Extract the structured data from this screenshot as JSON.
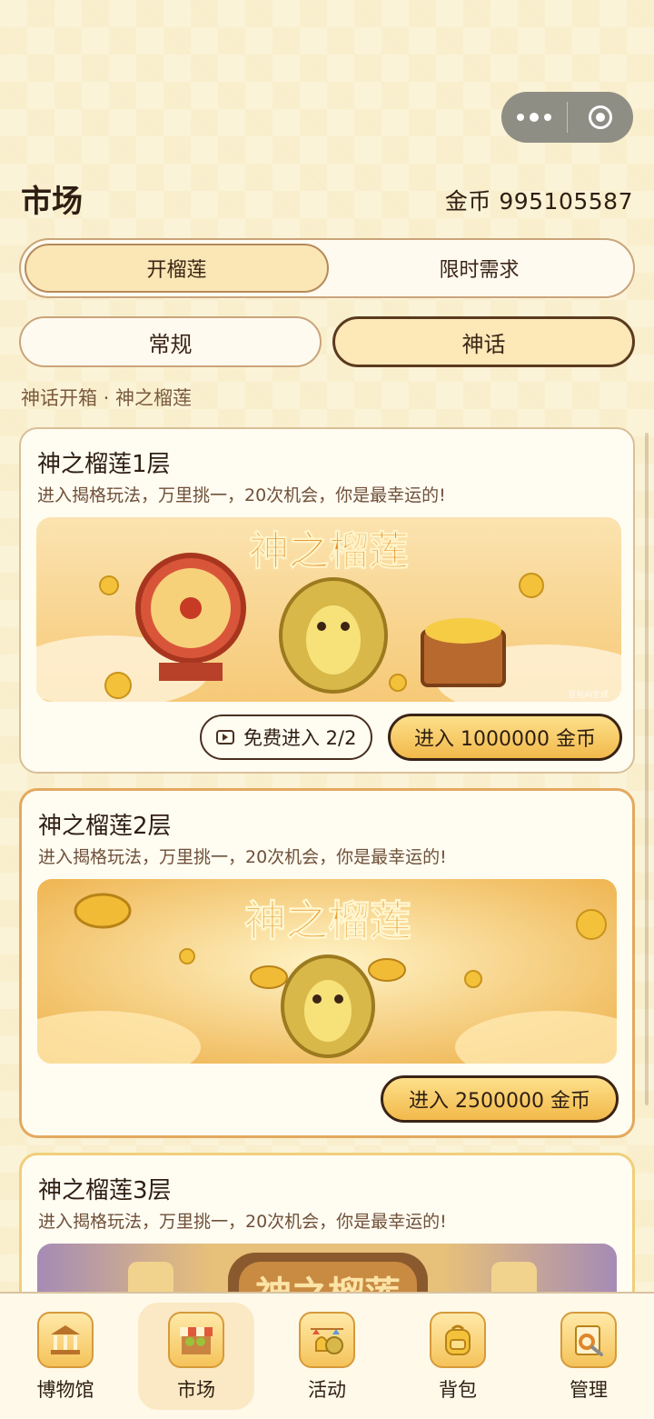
{
  "header": {
    "title": "市场",
    "coins_label": "金币 995105587"
  },
  "segments": [
    {
      "label": "开榴莲",
      "active": true
    },
    {
      "label": "限时需求",
      "active": false
    }
  ],
  "filters": [
    {
      "label": "常规",
      "active": false
    },
    {
      "label": "神话",
      "active": true
    }
  ],
  "breadcrumb": "神话开箱 · 神之榴莲",
  "cards": [
    {
      "title": "神之榴莲1层",
      "desc": "进入揭格玩法，万里挑一，20次机会，你是最幸运的!",
      "banner_text": "神之榴莲",
      "watermark": "豆包AI生成",
      "free_label": "免费进入 2/2",
      "enter_label": "进入 1000000 金币"
    },
    {
      "title": "神之榴莲2层",
      "desc": "进入揭格玩法，万里挑一，20次机会，你是最幸运的!",
      "banner_text": "神之榴莲",
      "enter_label": "进入 2500000 金币"
    },
    {
      "title": "神之榴莲3层",
      "desc": "进入揭格玩法，万里挑一，20次机会，你是最幸运的!",
      "banner_text": "神之榴莲"
    }
  ],
  "tabs": [
    {
      "label": "博物馆",
      "icon": "museum-icon",
      "active": false
    },
    {
      "label": "市场",
      "icon": "market-stall-icon",
      "active": true
    },
    {
      "label": "活动",
      "icon": "event-bells-icon",
      "active": false
    },
    {
      "label": "背包",
      "icon": "backpack-icon",
      "active": false
    },
    {
      "label": "管理",
      "icon": "settings-tools-icon",
      "active": false
    }
  ],
  "colors": {
    "background": "#fbf3d7",
    "accent_gold": "#f2b94b",
    "dark_brown": "#3b2414",
    "card_highlight_border": "#e3a95f"
  }
}
